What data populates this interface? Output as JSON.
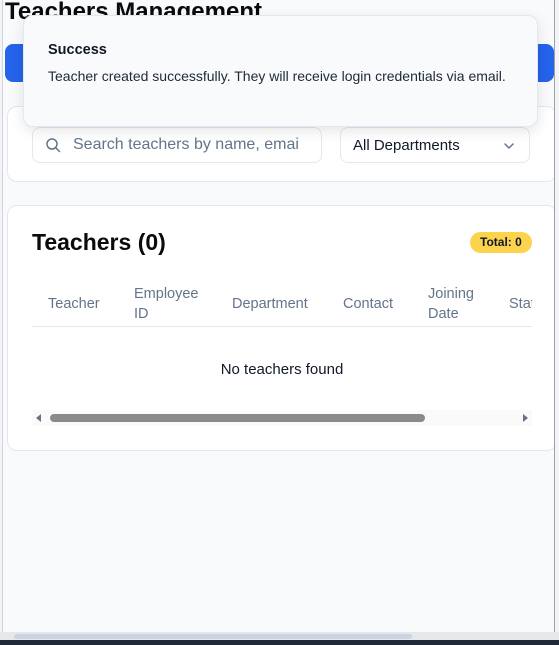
{
  "page": {
    "title": "Teachers Management"
  },
  "filters": {
    "search_placeholder": "Search teachers by name, email...",
    "search_visible_text": "Search teachers by name, emai",
    "department_selected": "All Departments"
  },
  "teachers": {
    "title": "Teachers (0)",
    "total_badge": "Total: 0",
    "columns": {
      "teacher": "Teacher",
      "employee_id_1": "Employee",
      "employee_id_2": "ID",
      "department": "Department",
      "contact": "Contact",
      "joining_1": "Joining",
      "joining_2": "Date",
      "status": "Status"
    },
    "empty_message": "No teachers found"
  },
  "toast": {
    "title": "Success",
    "message": "Teacher created successfully. They will receive login credentials via email."
  },
  "colors": {
    "primary": "#2563eb",
    "badge": "#fcd34d"
  },
  "icons": [
    "search-icon",
    "chevron-down-icon",
    "scroll-left-icon",
    "scroll-right-icon"
  ]
}
